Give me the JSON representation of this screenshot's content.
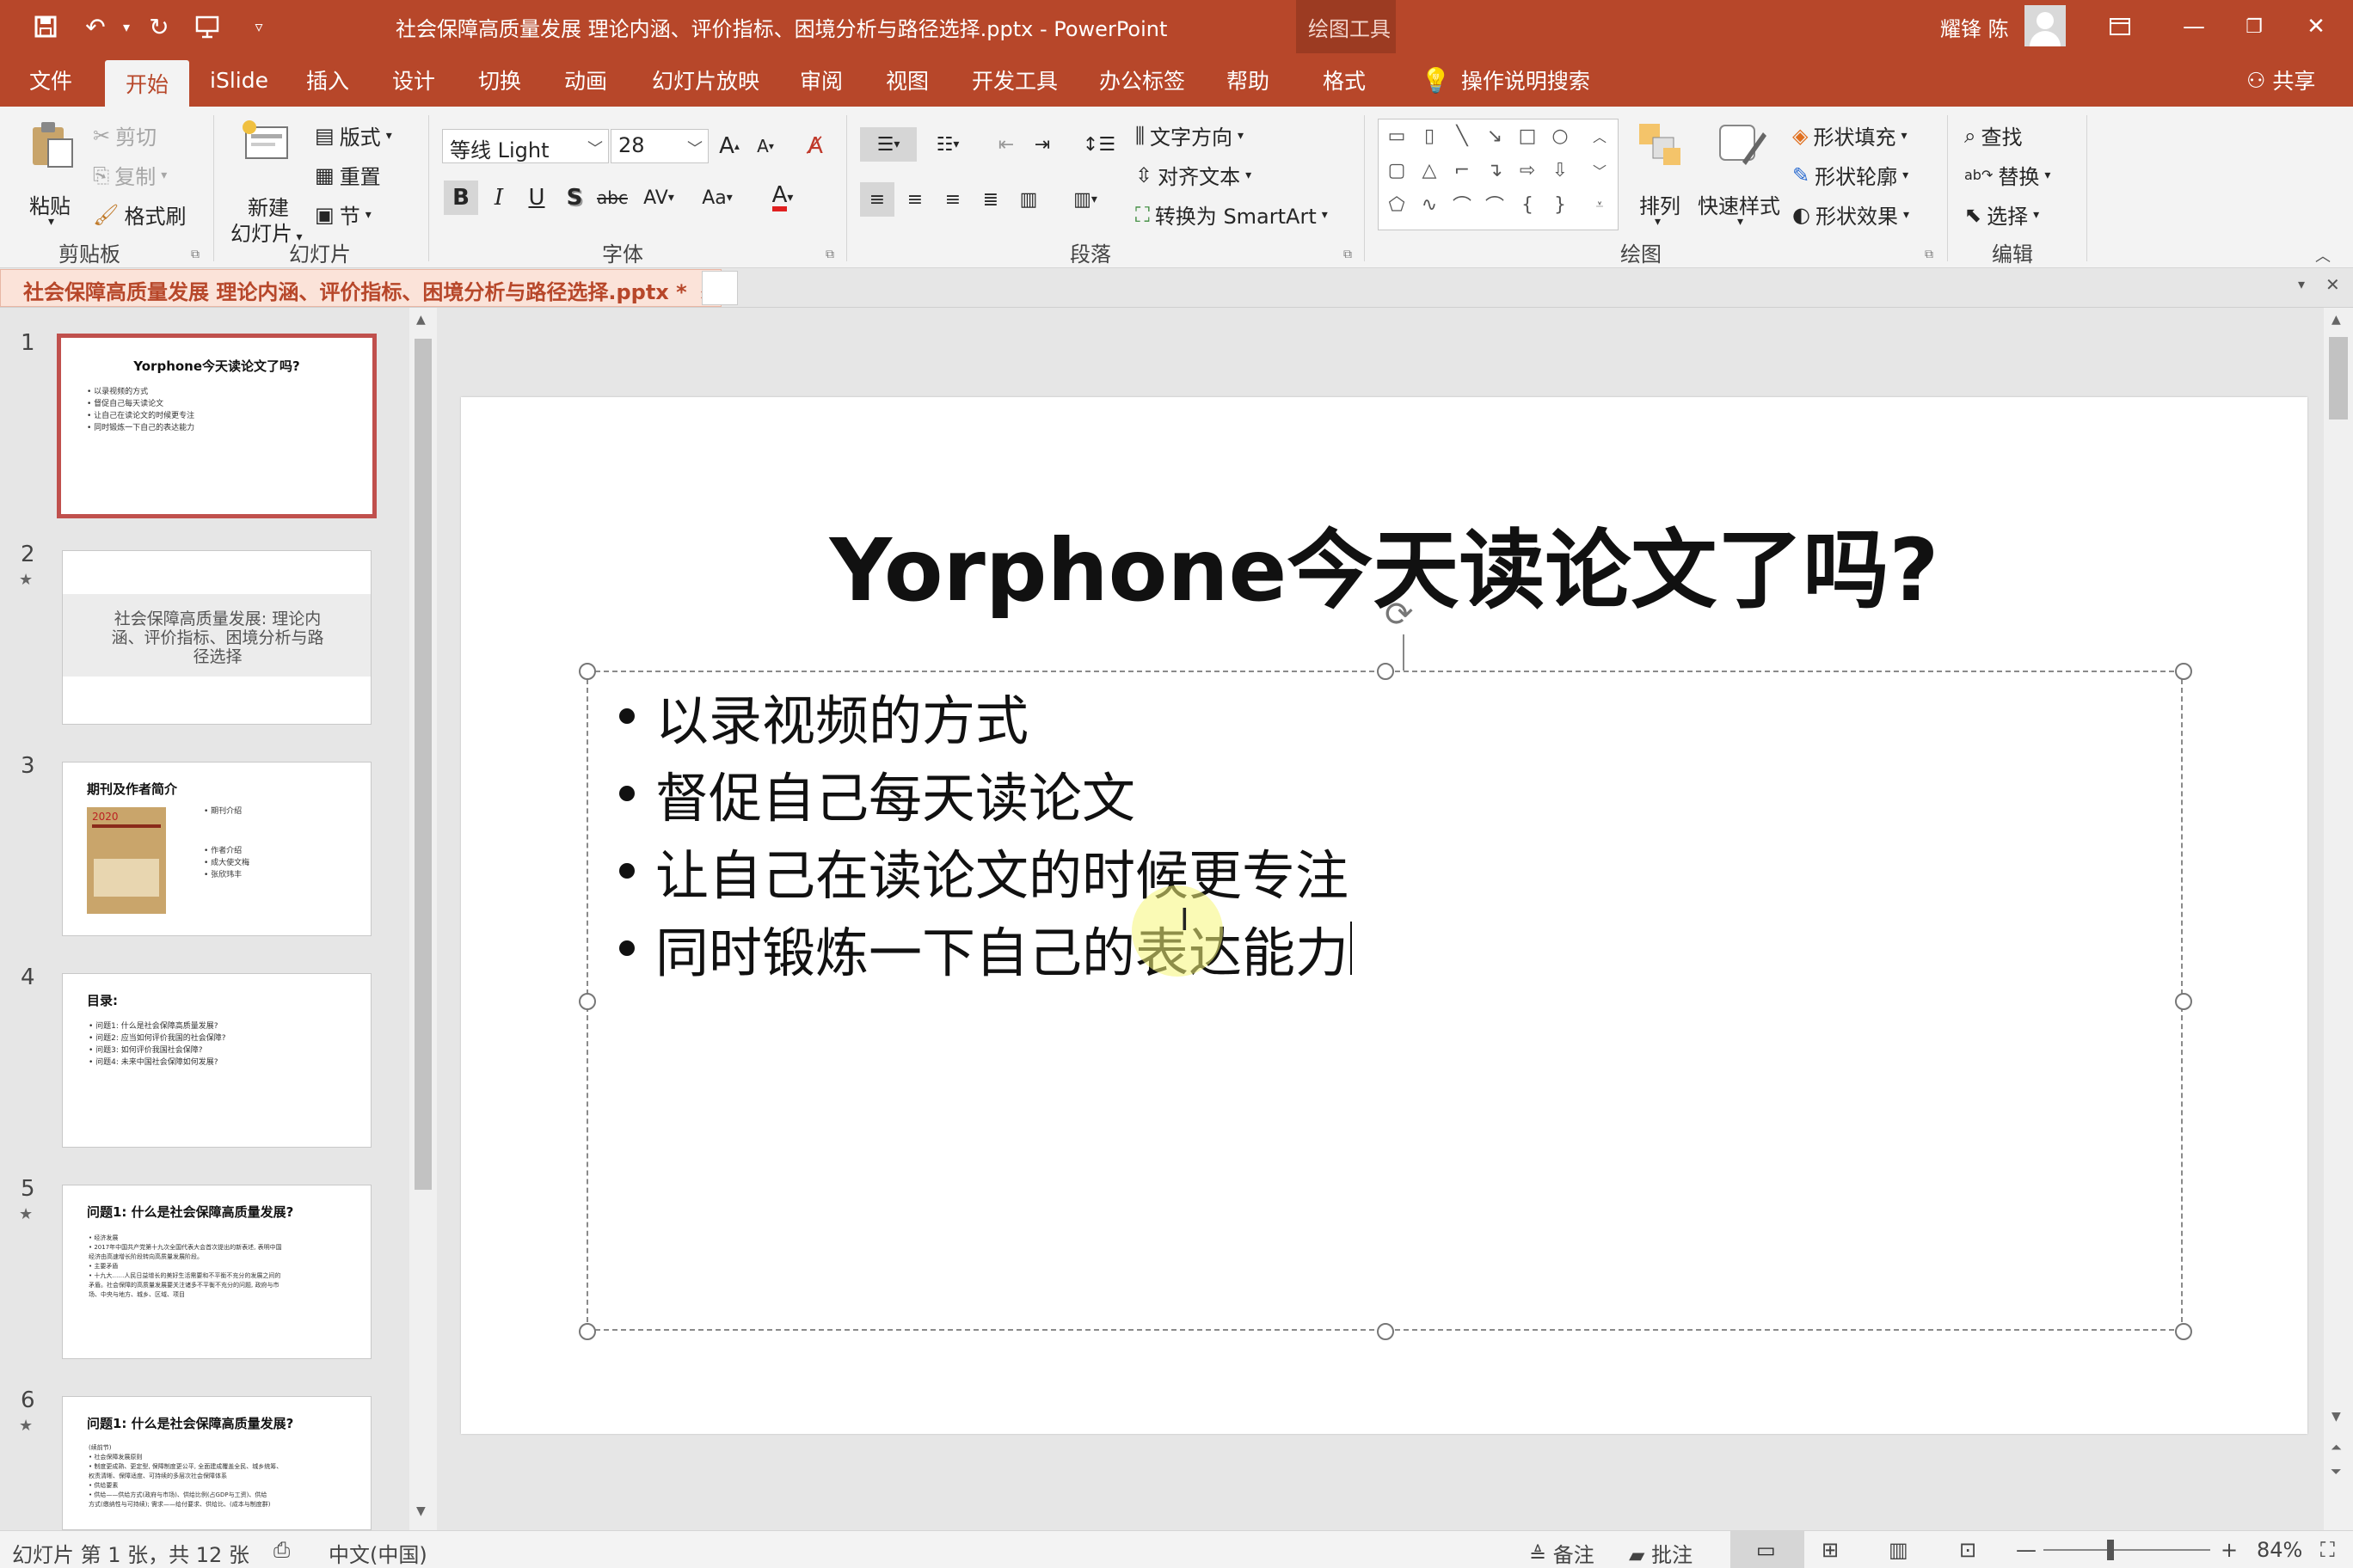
{
  "window": {
    "title": "社会保障高质量发展 理论内涵、评价指标、困境分析与路径选择.pptx - PowerPoint",
    "context_tools": "绘图工具",
    "user_name": "耀锋 陈"
  },
  "tabs": [
    "文件",
    "开始",
    "iSlide",
    "插入",
    "设计",
    "切换",
    "动画",
    "幻灯片放映",
    "审阅",
    "视图",
    "开发工具",
    "办公标签",
    "帮助",
    "格式"
  ],
  "active_tab": "开始",
  "tell_me": "操作说明搜索",
  "share": "共享",
  "ribbon": {
    "clipboard": {
      "paste": "粘贴",
      "cut": "剪切",
      "copy": "复制",
      "format_painter": "格式刷",
      "label": "剪贴板"
    },
    "slides": {
      "new_slide_1": "新建",
      "new_slide_2": "幻灯片",
      "layout": "版式",
      "reset": "重置",
      "section": "节",
      "label": "幻灯片"
    },
    "font": {
      "font_name": "等线 Light",
      "font_size": "28",
      "label": "字体"
    },
    "paragraph": {
      "text_direction": "文字方向",
      "align_text": "对齐文本",
      "smartart": "转换为 SmartArt",
      "label": "段落"
    },
    "drawing": {
      "arrange": "排列",
      "quick_styles": "快速样式",
      "shape_fill": "形状填充",
      "shape_outline": "形状轮廓",
      "shape_effects": "形状效果",
      "label": "绘图"
    },
    "editing": {
      "find": "查找",
      "replace": "替换",
      "select": "选择",
      "label": "编辑"
    }
  },
  "doc_tab": "社会保障高质量发展 理论内涵、评价指标、困境分析与路径选择.pptx *",
  "thumbnails": [
    {
      "num": "1",
      "title": "Yorphone今天读论文了吗?",
      "lines": [
        "• 以录视频的方式",
        "• 督促自己每天读论文",
        "• 让自己在读论文的时候更专注",
        "• 同时锻炼一下自己的表达能力"
      ]
    },
    {
      "num": "2",
      "title": "社会保障高质量发展: 理论内",
      "title2": "涵、评价指标、困境分析与路",
      "title3": "径选择"
    },
    {
      "num": "3",
      "title": "期刊及作者简介",
      "lines": [
        "• 期刊介绍",
        "• 作者介绍",
        "  • 成大使文梅",
        "  • 张欣玮丰"
      ],
      "badge": "2020"
    },
    {
      "num": "4",
      "title": "目录:",
      "lines": [
        "• 问题1: 什么是社会保障高质量发展?",
        "• 问题2: 应当如何评价我国的社会保障?",
        "• 问题3: 如何评价我国社会保障?",
        "• 问题4: 未来中国社会保障如何发展?"
      ]
    },
    {
      "num": "5",
      "title": "问题1: 什么是社会保障高质量发展?",
      "lines": [
        "• 经济发展",
        "  • 2017年中国共产党第十九次全国代表大会首次提出的新表述, 表明中国",
        "    经济由高速增长阶段转向高质量发展阶段。",
        "• 主要矛盾",
        "  • 十九大……人民日益增长的美好生活需要和不平衡不充分的发展之间的",
        "    矛盾。社会保障的高质量发展要关注诸多不平衡不充分的问题, 政府与市",
        "    场、中央与地方、城乡、区域、项目"
      ]
    },
    {
      "num": "6",
      "title": "问题1: 什么是社会保障高质量发展?",
      "lines": [
        "(续前节)",
        "• 社会保障发展原则",
        "  • 制度更成熟、更定型, 保障制度更公平, 全面建成覆盖全民、城乡统筹、",
        "    权责清晰、保障适度、可持续的多层次社会保障体系",
        "• 供给要素",
        "  • 供给——供给方式(政府与市场)、供给比例(占GDP与工资)、供给",
        "    方式(缴纳性与可持续); 需求——给付要求、供给比、(成本与制度群)"
      ]
    }
  ],
  "slide": {
    "title": "Yorphone今天读论文了吗?",
    "bullets": [
      "以录视频的方式",
      "督促自己每天读论文",
      "让自己在读论文的时候更专注",
      "同时锻炼一下自己的表达能力"
    ]
  },
  "status": {
    "slide_info": "幻灯片 第 1 张，共 12 张",
    "language": "中文(中国)",
    "notes": "备注",
    "comments": "批注",
    "zoom": "84%"
  }
}
